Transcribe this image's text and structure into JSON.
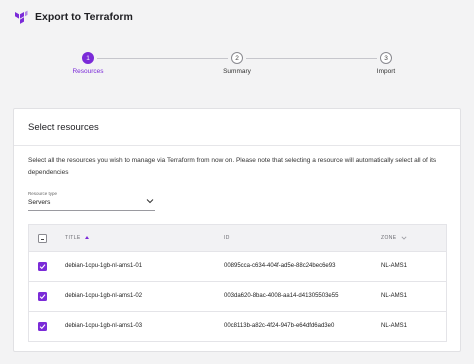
{
  "header": {
    "title": "Export to Terraform",
    "brand_color": "#7b2bd8"
  },
  "stepper": {
    "steps": [
      {
        "number": "1",
        "label": "Resources",
        "state": "active"
      },
      {
        "number": "2",
        "label": "Summary",
        "state": "pending"
      },
      {
        "number": "3",
        "label": "Import",
        "state": "pending"
      }
    ]
  },
  "card": {
    "title": "Select resources",
    "description": "Select all the resources you wish to manage via Terraform from now on. Please note that selecting a resource will automatically select all of its dependencies",
    "resource_type": {
      "label": "Resource type",
      "value": "Servers"
    },
    "table": {
      "columns": {
        "title": "TITLE",
        "id": "ID",
        "zone": "ZONE"
      },
      "rows": [
        {
          "selected": true,
          "title": "debian-1cpu-1gb-nl-ams1-01",
          "id": "00895cca-c634-404f-ad5e-88c24bec6e93",
          "zone": "NL-AMS1"
        },
        {
          "selected": true,
          "title": "debian-1cpu-1gb-nl-ams1-02",
          "id": "003da620-8bac-4008-aa14-d41305503e55",
          "zone": "NL-AMS1"
        },
        {
          "selected": true,
          "title": "debian-1cpu-1gb-nl-ams1-03",
          "id": "00c8113b-a82c-4f24-947b-e64dfd6ad3e0",
          "zone": "NL-AMS1"
        }
      ]
    }
  }
}
